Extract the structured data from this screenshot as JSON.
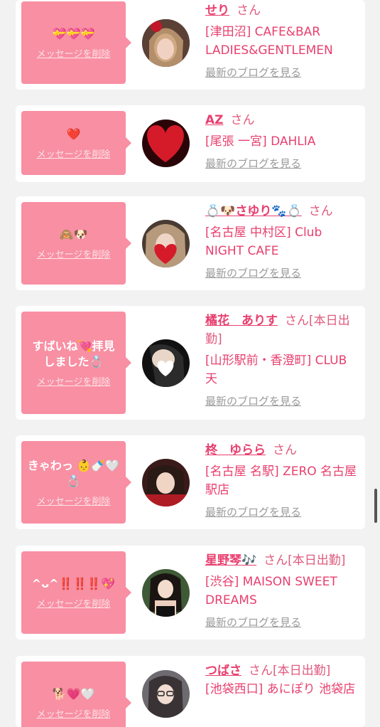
{
  "items": [
    {
      "message": "💝💝💝",
      "delete_label": "メッセージを削除",
      "name": "せり",
      "suffix": "さん",
      "shop": "[津田沼] CAFE&BAR LADIES&GENTLEMEN",
      "blog_label": "最新のブログを見る",
      "avatar_color": "#3a2a2a"
    },
    {
      "message": "❤️",
      "delete_label": "メッセージを削除",
      "name": "AZ",
      "suffix": "さん",
      "shop": "[尾張 一宮] DAHLIA",
      "blog_label": "最新のブログを見る",
      "avatar_color": "#c81c2a"
    },
    {
      "message": "🙈🐶",
      "delete_label": "メッセージを削除",
      "name": "💍🐶さゆり🐾💍",
      "suffix": "さん",
      "shop": "[名古屋 中村区] Club NIGHT CAFE",
      "blog_label": "最新のブログを見る",
      "avatar_color": "#4a3b32"
    },
    {
      "message": "すばいね💘拝見しました💍",
      "delete_label": "メッセージを削除",
      "name": "橘花　ありす",
      "suffix": "さん[本日出勤]",
      "shop": "[山形駅前・香澄町] CLUB 天",
      "blog_label": "最新のブログを見る",
      "avatar_color": "#1e1e1e"
    },
    {
      "message": "きゃわっ 👶🍼🤍💍",
      "delete_label": "メッセージを削除",
      "name": "柊　ゆらら",
      "suffix": "さん",
      "shop": "[名古屋 名駅] ZERO 名古屋駅店",
      "blog_label": "最新のブログを見る",
      "avatar_color": "#3b1a1a"
    },
    {
      "message": "^ᴗ^‼️‼️‼️💖",
      "delete_label": "メッセージを削除",
      "name": "星野琴🎶",
      "suffix": "さん[本日出勤]",
      "shop": "[渋谷] MAISON SWEET DREAMS",
      "blog_label": "最新のブログを見る",
      "avatar_color": "#2d3d2a"
    },
    {
      "message": "🐕💗🤍",
      "delete_label": "メッセージを削除",
      "name": "つばさ",
      "suffix": "さん[本日出勤]",
      "shop": "[池袋西口] あにぽり 池袋店",
      "blog_label": "",
      "avatar_color": "#6d6a70"
    }
  ],
  "colors": {
    "accent": "#e83f6e",
    "bubble": "#f88fa3",
    "background": "#f2f2f2"
  }
}
